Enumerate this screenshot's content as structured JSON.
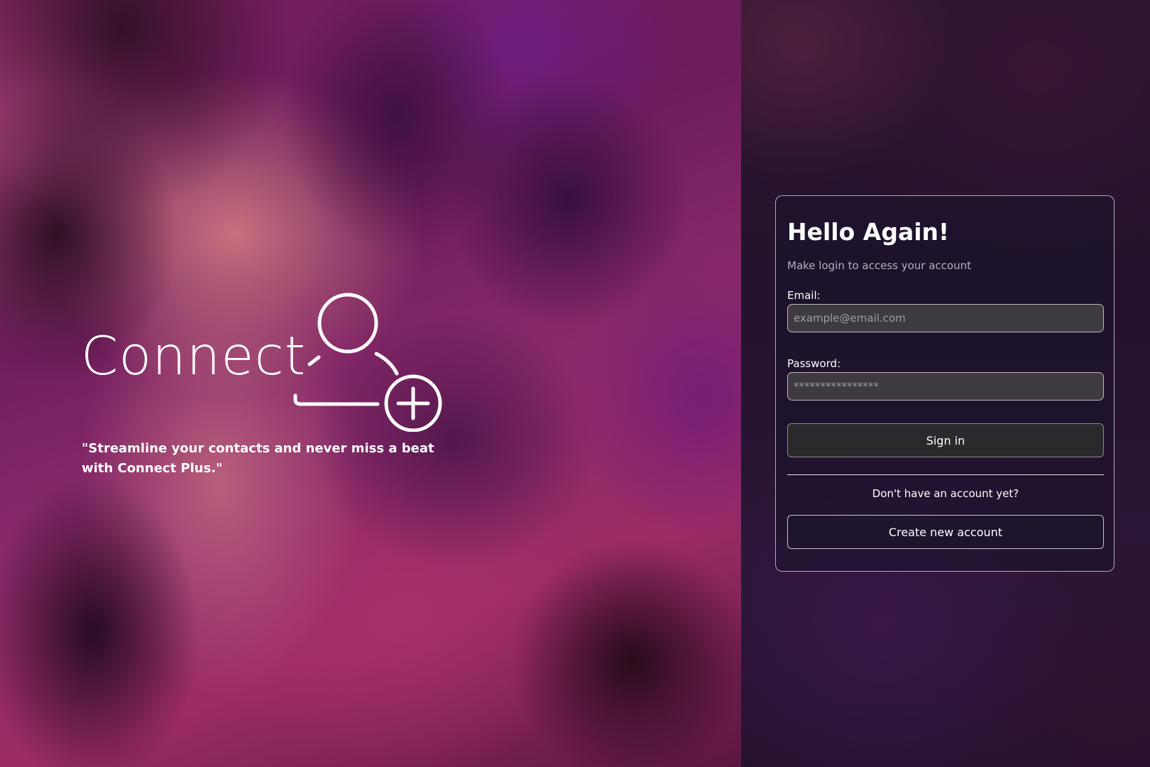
{
  "hero": {
    "logo_text": "Connect",
    "logo_icon": "add-user-icon",
    "tagline": "\"Streamline your contacts and never miss a beat with Connect Plus.\""
  },
  "login": {
    "title": "Hello Again!",
    "subtitle": "Make login to access your account",
    "email_label": "Email:",
    "email_placeholder": "example@email.com",
    "email_value": "",
    "password_label": "Password:",
    "password_placeholder": "****************",
    "password_value": "",
    "signin_label": "Sign in",
    "no_account_text": "Don't have an account yet?",
    "create_account_label": "Create new account"
  },
  "colors": {
    "hero_primary": "#8a2a6a",
    "panel_background": "#24122e",
    "input_background": "#3d3b40",
    "signin_button": "#2a2a2d",
    "text_primary": "#ffffff",
    "text_muted": "#b7aec4"
  }
}
